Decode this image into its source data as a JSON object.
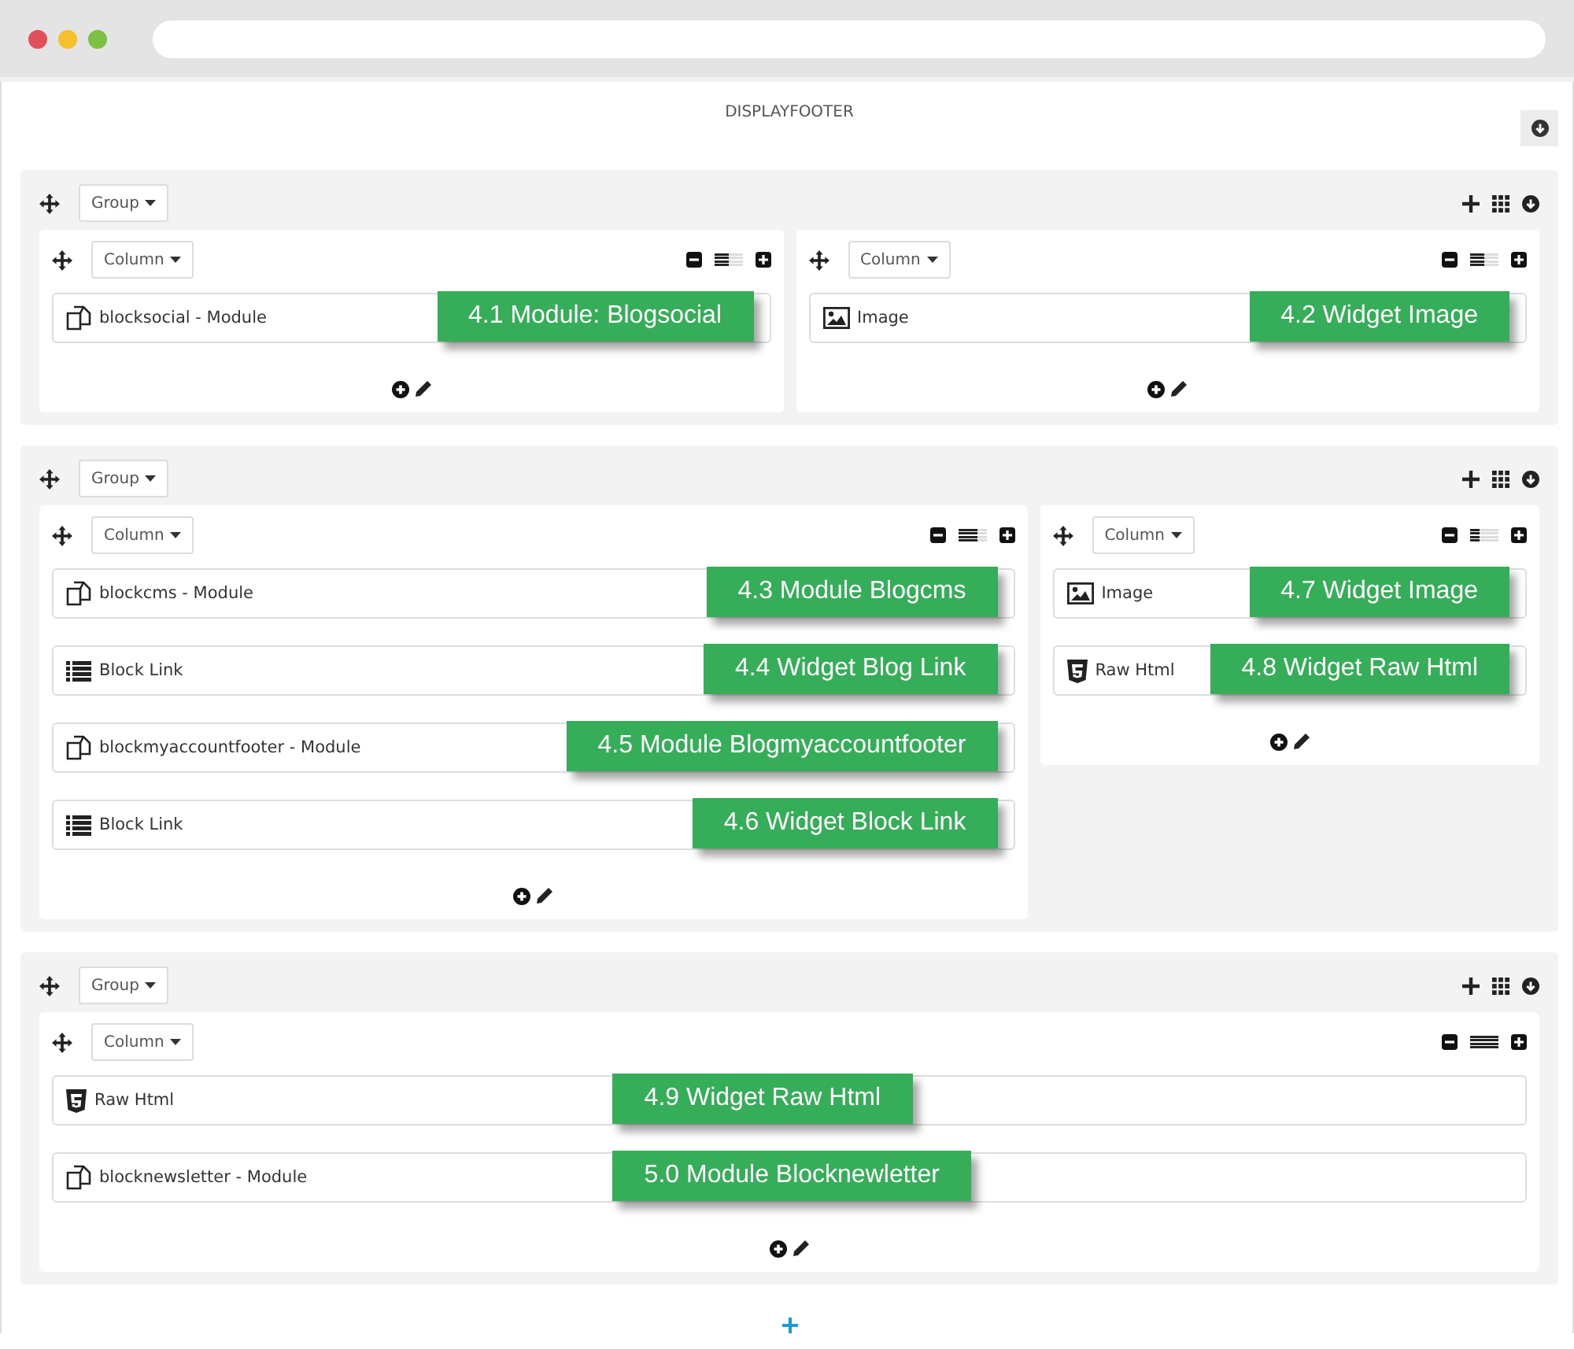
{
  "title": "DISPLAYFOOTER",
  "groups": [
    {
      "label": "Group",
      "columns": [
        {
          "label": "Column",
          "level": 0.5,
          "items": [
            {
              "kind": "module",
              "label": "blocksocial - Module",
              "callout": "4.1 Module: Blogsocial"
            }
          ]
        },
        {
          "label": "Column",
          "level": 0.5,
          "items": [
            {
              "kind": "image",
              "label": "Image",
              "callout": "4.2 Widget Image"
            }
          ]
        }
      ]
    },
    {
      "label": "Group",
      "columns": [
        {
          "label": "Column",
          "level": 0.67,
          "items": [
            {
              "kind": "module",
              "label": "blockcms - Module",
              "callout": "4.3 Module Blogcms"
            },
            {
              "kind": "list",
              "label": "Block Link",
              "callout": "4.4 Widget Blog Link"
            },
            {
              "kind": "module",
              "label": "blockmyaccountfooter - Module",
              "callout": "4.5 Module Blogmyaccountfooter"
            },
            {
              "kind": "list",
              "label": "Block Link",
              "callout": "4.6 Widget Block Link"
            }
          ]
        },
        {
          "label": "Column",
          "level": 0.33,
          "items": [
            {
              "kind": "image",
              "label": "Image",
              "callout": "4.7 Widget Image"
            },
            {
              "kind": "html",
              "label": "Raw Html",
              "callout": "4.8 Widget Raw Html"
            }
          ]
        }
      ]
    },
    {
      "label": "Group",
      "columns": [
        {
          "label": "Column",
          "level": 1,
          "items": [
            {
              "kind": "html",
              "label": "Raw Html",
              "callout": "4.9 Widget Raw Html"
            },
            {
              "kind": "module",
              "label": "blocknewsletter - Module",
              "callout": "5.0 Module Blocknewletter"
            }
          ]
        }
      ]
    }
  ]
}
